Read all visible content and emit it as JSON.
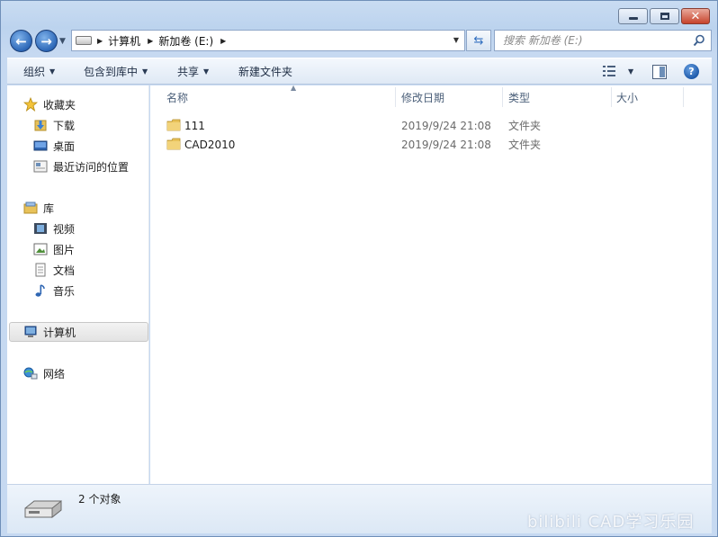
{
  "window": {
    "caption_buttons": [
      "minimize",
      "maximize",
      "close"
    ]
  },
  "nav": {
    "back_icon": "back-arrow-icon",
    "forward_icon": "forward-arrow-icon"
  },
  "address": {
    "crumbs": [
      "计算机",
      "新加卷 (E:)"
    ]
  },
  "search": {
    "placeholder": "搜索 新加卷 (E:)"
  },
  "toolbar": {
    "organize": "组织",
    "include_in_library": "包含到库中",
    "share": "共享",
    "new_folder": "新建文件夹"
  },
  "sidebar": {
    "favorites": {
      "label": "收藏夹",
      "items": [
        "下载",
        "桌面",
        "最近访问的位置"
      ]
    },
    "libraries": {
      "label": "库",
      "items": [
        "视频",
        "图片",
        "文档",
        "音乐"
      ]
    },
    "computer": "计算机",
    "network": "网络"
  },
  "columns": {
    "name": "名称",
    "date": "修改日期",
    "type": "类型",
    "size": "大小"
  },
  "files": [
    {
      "name": "111",
      "date": "2019/9/24 21:08",
      "type": "文件夹"
    },
    {
      "name": "CAD2010",
      "date": "2019/9/24 21:08",
      "type": "文件夹"
    }
  ],
  "status": {
    "count_text": "2 个对象"
  },
  "watermark": "bilibili CAD学习乐园",
  "colors": {
    "accent": "#2d68b8",
    "folder": "#e8c25a",
    "close_button": "#c7432c"
  }
}
